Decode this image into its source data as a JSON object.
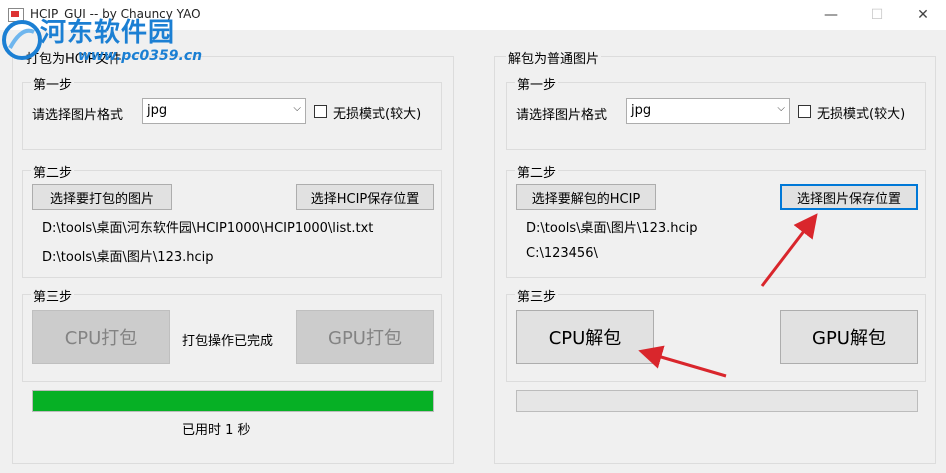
{
  "window": {
    "title": "HCIP_GUI -- by Chauncy YAO",
    "minimize_glyph": "—",
    "maximize_glyph": "☐",
    "close_glyph": "✕"
  },
  "watermark": {
    "name": "河东软件园",
    "url": "www.pc0359.cn"
  },
  "left": {
    "title": "打包为HCIP文件",
    "step1": {
      "title": "第一步",
      "format_label": "请选择图片格式",
      "format_value": "jpg",
      "lossless_label": "无损模式(较大)",
      "lossless_checked": false
    },
    "step2": {
      "title": "第二步",
      "select_images_btn": "选择要打包的图片",
      "select_save_btn": "选择HCIP保存位置",
      "images_path": "D:\\tools\\桌面\\河东软件园\\HCIP1000\\HCIP1000\\list.txt",
      "save_path": "D:\\tools\\桌面\\图片\\123.hcip"
    },
    "step3": {
      "title": "第三步",
      "cpu_btn": "CPU打包",
      "gpu_btn": "GPU打包",
      "status": "打包操作已完成"
    },
    "progress": 1.0,
    "elapsed": "已用时 1 秒"
  },
  "right": {
    "title": "解包为普通图片",
    "step1": {
      "title": "第一步",
      "format_label": "请选择图片格式",
      "format_value": "jpg",
      "lossless_label": "无损模式(较大)",
      "lossless_checked": false
    },
    "step2": {
      "title": "第二步",
      "select_hcip_btn": "选择要解包的HCIP",
      "select_save_btn": "选择图片保存位置",
      "hcip_path": "D:\\tools\\桌面\\图片\\123.hcip",
      "save_path": "C:\\123456\\"
    },
    "step3": {
      "title": "第三步",
      "cpu_btn": "CPU解包",
      "gpu_btn": "GPU解包"
    },
    "progress": 0.0
  },
  "colors": {
    "progress_fill": "#06b025",
    "watermark": "#1b7fd3",
    "arrow": "#d9262c",
    "focus": "#0078d7"
  }
}
